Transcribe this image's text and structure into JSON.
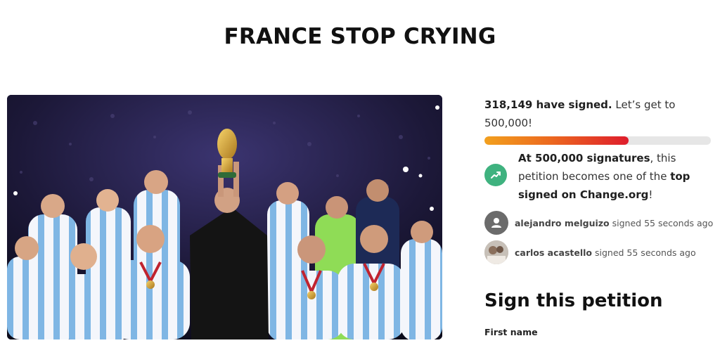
{
  "petition": {
    "title": "FRANCE STOP CRYING"
  },
  "hero_image": {
    "icon": "team-celebration-photo"
  },
  "progress": {
    "signed_count": "318,149 have signed.",
    "goal_text": " Let’s get to 500,000!",
    "fraction": 0.636
  },
  "milestone": {
    "icon": "trending-up-icon",
    "color": "#3fb27f",
    "bold_1": "At 500,000 signatures",
    "text_1": ", this petition becomes one of the ",
    "bold_2": "top signed on Change.org",
    "text_2": "!"
  },
  "recent_signers": [
    {
      "name": "alejandro melguizo",
      "action": " signed 55 seconds ago",
      "avatar": "default-avatar-icon"
    },
    {
      "name": "carlos acastello",
      "action": " signed 55 seconds ago",
      "avatar": "user-photo-avatar"
    }
  ],
  "sign_form": {
    "heading": "Sign this petition",
    "first_name_label": "First name"
  },
  "colors": {
    "progress_start": "#f2a01e",
    "progress_end": "#de1d2c",
    "progress_track": "#e6e6e6"
  }
}
